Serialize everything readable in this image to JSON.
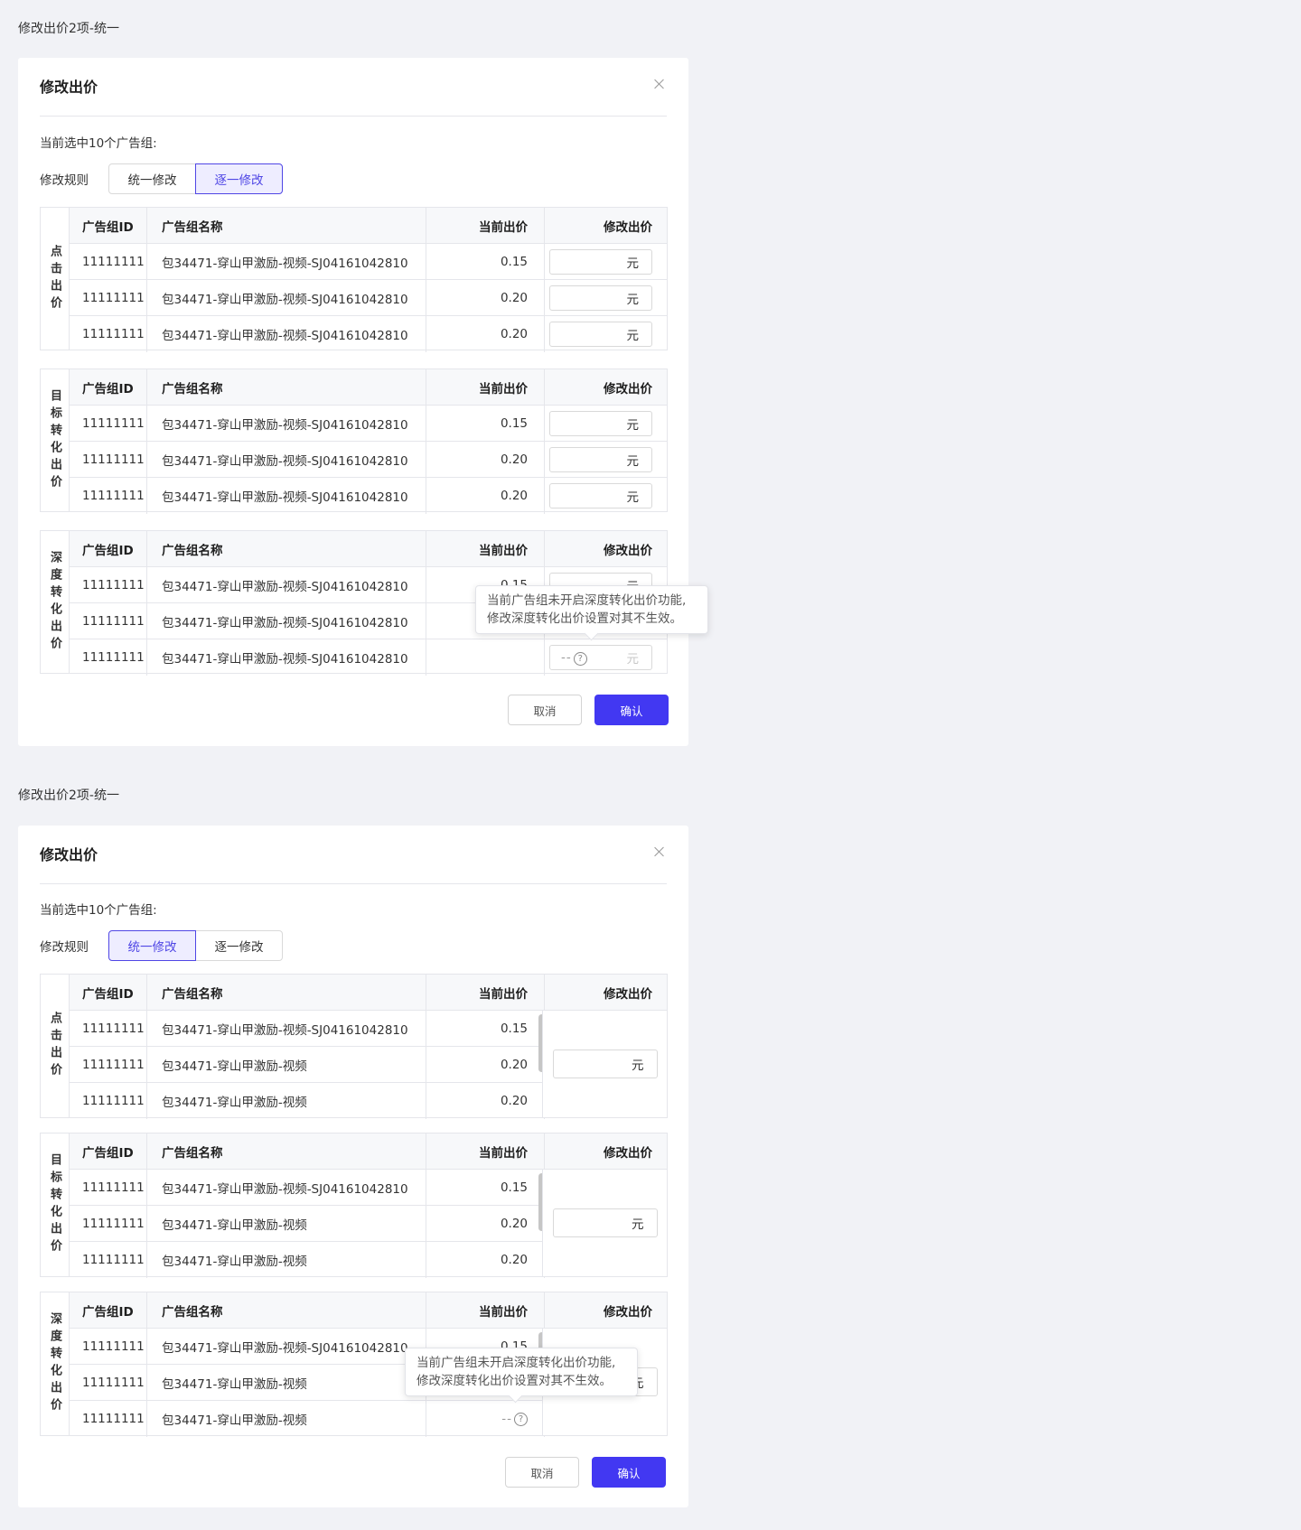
{
  "section_labels": [
    "修改出价2项-统一",
    "修改出价2项-统一"
  ],
  "modal": {
    "title": "修改出价",
    "selected_info": "当前选中10个广告组:",
    "rule_label": "修改规则",
    "rule_options": [
      "统一修改",
      "逐一修改"
    ],
    "cancel_label": "取消",
    "confirm_label": "确认"
  },
  "columns": {
    "id": "广告组ID",
    "name": "广告组名称",
    "price": "当前出价",
    "edit": "修改出价"
  },
  "unit": "元",
  "dash": "--",
  "help": "?",
  "tooltip": {
    "line1": "当前广告组未开启深度转化出价功能,",
    "line2": "修改深度转化出价设置对其不生效。"
  },
  "modal1": {
    "active_rule": "逐一修改",
    "groups": [
      {
        "title": "点击出价",
        "rows": [
          {
            "id": "11111111",
            "name": "包34471-穿山甲激励-视频-SJ04161042810",
            "price": "0.15"
          },
          {
            "id": "11111111",
            "name": "包34471-穿山甲激励-视频-SJ04161042810",
            "price": "0.20"
          },
          {
            "id": "11111111",
            "name": "包34471-穿山甲激励-视频-SJ04161042810",
            "price": "0.20"
          }
        ]
      },
      {
        "title": "目标转化出价",
        "rows": [
          {
            "id": "11111111",
            "name": "包34471-穿山甲激励-视频-SJ04161042810",
            "price": "0.15"
          },
          {
            "id": "11111111",
            "name": "包34471-穿山甲激励-视频-SJ04161042810",
            "price": "0.20"
          },
          {
            "id": "11111111",
            "name": "包34471-穿山甲激励-视频-SJ04161042810",
            "price": "0.20"
          }
        ]
      },
      {
        "title": "深度转化出价",
        "rows": [
          {
            "id": "11111111",
            "name": "包34471-穿山甲激励-视频-SJ04161042810",
            "price": "0.15"
          },
          {
            "id": "11111111",
            "name": "包34471-穿山甲激励-视频-SJ04161042810",
            "price": ""
          },
          {
            "id": "11111111",
            "name": "包34471-穿山甲激励-视频-SJ04161042810",
            "price": ""
          }
        ]
      }
    ]
  },
  "modal2": {
    "active_rule": "统一修改",
    "groups": [
      {
        "title": "点击出价",
        "rows": [
          {
            "id": "11111111",
            "name": "包34471-穿山甲激励-视频-SJ04161042810",
            "price": "0.15"
          },
          {
            "id": "11111111",
            "name": "包34471-穿山甲激励-视频",
            "price": "0.20"
          },
          {
            "id": "11111111",
            "name": "包34471-穿山甲激励-视频",
            "price": "0.20"
          }
        ]
      },
      {
        "title": "目标转化出价",
        "rows": [
          {
            "id": "11111111",
            "name": "包34471-穿山甲激励-视频-SJ04161042810",
            "price": "0.15"
          },
          {
            "id": "11111111",
            "name": "包34471-穿山甲激励-视频",
            "price": "0.20"
          },
          {
            "id": "11111111",
            "name": "包34471-穿山甲激励-视频",
            "price": "0.20"
          }
        ]
      },
      {
        "title": "深度转化出价",
        "rows": [
          {
            "id": "11111111",
            "name": "包34471-穿山甲激励-视频-SJ04161042810",
            "price": "0.15"
          },
          {
            "id": "11111111",
            "name": "包34471-穿山甲激励-视频",
            "price": ""
          },
          {
            "id": "11111111",
            "name": "包34471-穿山甲激励-视频",
            "price": ""
          }
        ]
      }
    ]
  }
}
